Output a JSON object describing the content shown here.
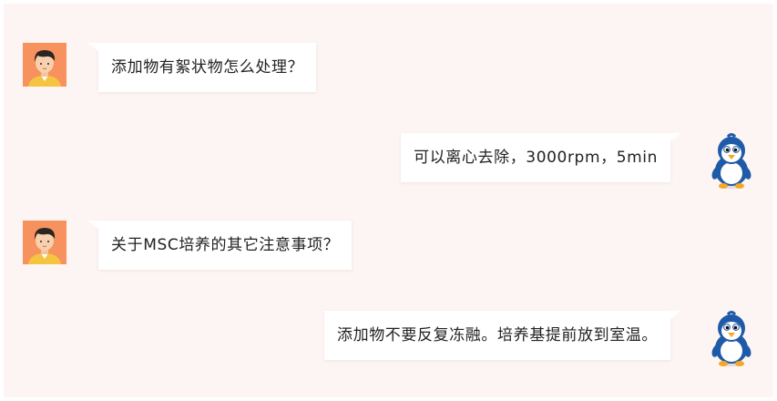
{
  "colors": {
    "page_background": "#ffffff",
    "chat_background": "#fdf5f3",
    "bubble_background": "#ffffff",
    "text": "#222222",
    "user_avatar_background": "#f7925e",
    "bot_avatar_primary": "#1e5aa8",
    "bot_avatar_accent": "#f5a623"
  },
  "messages": [
    {
      "sender": "user",
      "avatar_icon": "user-avatar-icon",
      "text": "添加物有絮状物怎么处理？"
    },
    {
      "sender": "bot",
      "avatar_icon": "penguin-mascot-icon",
      "text": "可以离心去除，3000rpm，5min"
    },
    {
      "sender": "user",
      "avatar_icon": "user-avatar-icon",
      "text": "关于MSC培养的其它注意事项？"
    },
    {
      "sender": "bot",
      "avatar_icon": "penguin-mascot-icon",
      "text": "添加物不要反复冻融。培养基提前放到室温。"
    }
  ]
}
